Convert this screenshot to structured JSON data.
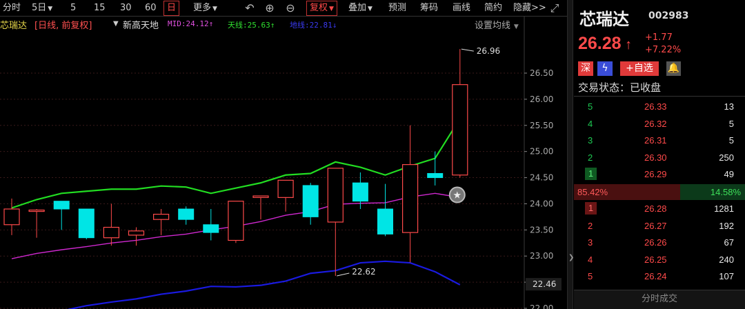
{
  "toolbar": {
    "items": [
      "分时",
      "5日",
      "5",
      "15",
      "30",
      "60",
      "日",
      "更多",
      "复权",
      "叠加",
      "预测",
      "筹码",
      "画线",
      "简约",
      "隐藏>>"
    ],
    "icons": [
      "undo-icon",
      "zoom-in-icon",
      "zoom-out-icon",
      "fullscreen-icon"
    ]
  },
  "legend": {
    "stock": "芯瑞达",
    "mode": "[日线, 前复权]",
    "indicator": "新高天地",
    "mid": "MID:24.12↑",
    "top_line": "天线:25.63↑",
    "bottom_line": "地线:22.81↓",
    "setting": "设置均线"
  },
  "colors": {
    "up": "#ff4a4a",
    "down": "#00e5e5",
    "top_line": "#22dd22",
    "mid_line": "#d028d0",
    "bottom_line": "#1a1ae0"
  },
  "chart_data": {
    "type": "candlestick",
    "y_ticks": [
      "26.50",
      "26.00",
      "25.50",
      "25.00",
      "24.50",
      "24.00",
      "23.50",
      "23.00",
      "22.50",
      "22.00"
    ],
    "current_tag": "22.46",
    "high_label": "26.96",
    "low_label": "22.62",
    "candles": [
      {
        "o": 23.6,
        "c": 23.9,
        "h": 24.1,
        "l": 23.4,
        "dir": "up"
      },
      {
        "o": 23.88,
        "c": 23.86,
        "h": 23.9,
        "l": 23.35,
        "dir": "up"
      },
      {
        "o": 24.05,
        "c": 23.9,
        "h": 24.05,
        "l": 23.5,
        "dir": "down"
      },
      {
        "o": 23.9,
        "c": 23.35,
        "h": 23.9,
        "l": 23.32,
        "dir": "down"
      },
      {
        "o": 23.35,
        "c": 23.55,
        "h": 24.0,
        "l": 23.2,
        "dir": "up"
      },
      {
        "o": 23.4,
        "c": 23.48,
        "h": 23.55,
        "l": 23.2,
        "dir": "up"
      },
      {
        "o": 23.7,
        "c": 23.8,
        "h": 23.9,
        "l": 23.4,
        "dir": "up"
      },
      {
        "o": 23.9,
        "c": 23.7,
        "h": 23.95,
        "l": 23.6,
        "dir": "down"
      },
      {
        "o": 23.6,
        "c": 23.45,
        "h": 23.9,
        "l": 23.3,
        "dir": "down"
      },
      {
        "o": 23.3,
        "c": 24.05,
        "h": 24.05,
        "l": 23.25,
        "dir": "up"
      },
      {
        "o": 24.12,
        "c": 24.15,
        "h": 24.15,
        "l": 23.7,
        "dir": "up"
      },
      {
        "o": 24.12,
        "c": 24.45,
        "h": 24.45,
        "l": 23.85,
        "dir": "up"
      },
      {
        "o": 24.35,
        "c": 23.75,
        "h": 24.4,
        "l": 23.6,
        "dir": "down"
      },
      {
        "o": 23.65,
        "c": 24.68,
        "h": 24.68,
        "l": 22.62,
        "dir": "up"
      },
      {
        "o": 24.4,
        "c": 24.05,
        "h": 24.6,
        "l": 23.9,
        "dir": "down"
      },
      {
        "o": 23.9,
        "c": 23.42,
        "h": 24.38,
        "l": 23.38,
        "dir": "down"
      },
      {
        "o": 23.45,
        "c": 24.75,
        "h": 25.5,
        "l": 22.88,
        "dir": "up"
      },
      {
        "o": 24.58,
        "c": 24.5,
        "h": 25.0,
        "l": 24.35,
        "dir": "down"
      },
      {
        "o": 24.55,
        "c": 26.28,
        "h": 26.96,
        "l": 24.5,
        "dir": "up"
      }
    ],
    "top_line": [
      23.92,
      24.08,
      24.2,
      24.24,
      24.28,
      24.28,
      24.34,
      24.32,
      24.2,
      24.3,
      24.4,
      24.55,
      24.58,
      24.8,
      24.7,
      24.55,
      24.72,
      24.87,
      25.63
    ],
    "mid_line": [
      22.95,
      23.05,
      23.12,
      23.18,
      23.25,
      23.3,
      23.37,
      23.42,
      23.5,
      23.57,
      23.66,
      23.78,
      23.85,
      23.99,
      24.01,
      24.02,
      24.13,
      24.2,
      24.12
    ],
    "bottom_line": [
      21.75,
      21.85,
      21.95,
      22.05,
      22.12,
      22.18,
      22.27,
      22.33,
      22.42,
      22.41,
      22.44,
      22.52,
      22.67,
      22.72,
      22.87,
      22.9,
      22.87,
      22.7,
      22.45
    ],
    "star_marker_value": 24.17
  },
  "panel": {
    "name": "芯瑞达",
    "code": "002983",
    "price": "26.28",
    "change": "+1.77",
    "pct": "+7.22%",
    "badges": {
      "shen": "深",
      "fav": "+自选"
    },
    "status": "交易状态：已收盘",
    "asks": [
      {
        "lvl": "5",
        "price": "26.33",
        "vol": "13"
      },
      {
        "lvl": "4",
        "price": "26.32",
        "vol": "5"
      },
      {
        "lvl": "3",
        "price": "26.31",
        "vol": "5"
      },
      {
        "lvl": "2",
        "price": "26.30",
        "vol": "250"
      },
      {
        "lvl": "1",
        "price": "26.29",
        "vol": "49"
      }
    ],
    "ratio_left": "85.42%",
    "ratio_right": "14.58%",
    "bids": [
      {
        "lvl": "1",
        "price": "26.28",
        "vol": "1281"
      },
      {
        "lvl": "2",
        "price": "26.27",
        "vol": "192"
      },
      {
        "lvl": "3",
        "price": "26.26",
        "vol": "67"
      },
      {
        "lvl": "4",
        "price": "26.25",
        "vol": "240"
      },
      {
        "lvl": "5",
        "price": "26.24",
        "vol": "107"
      }
    ],
    "bottom_label": "分时成交"
  }
}
